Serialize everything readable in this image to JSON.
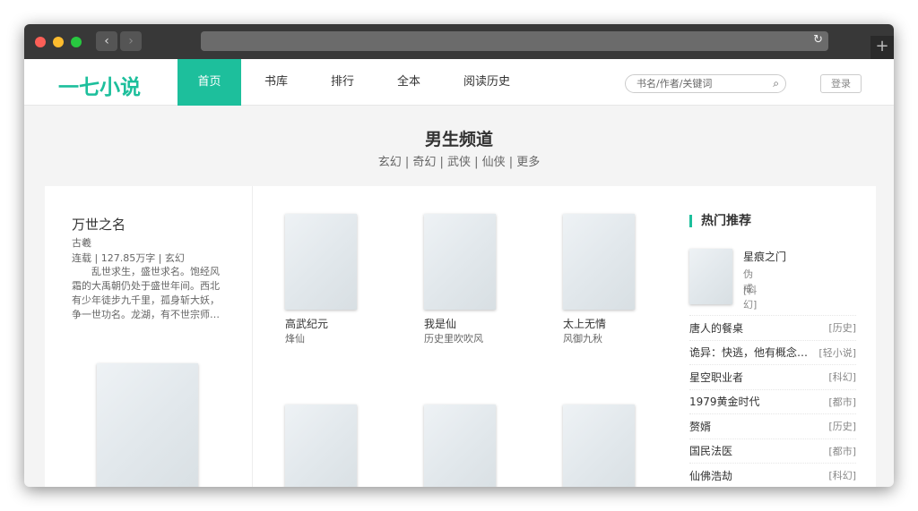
{
  "browser": {
    "back": "‹",
    "forward": "›",
    "reload_icon": "↻",
    "new_tab_icon": "+"
  },
  "header": {
    "logo": "一七小说",
    "nav": [
      "首页",
      "书库",
      "排行",
      "全本",
      "阅读历史"
    ],
    "search_placeholder": "书名/作者/关键词",
    "search_icon": "⌕",
    "login": "登录"
  },
  "channel": {
    "title": "男生频道",
    "categories": "玄幻 | 奇幻 | 武侠 | 仙侠 | 更多"
  },
  "featured": {
    "title": "万世之名",
    "author": "古羲",
    "meta": "连载 | 127.85万字 | 玄幻",
    "desc": "乱世求生，盛世求名。饱经风霜的大禹朝仍处于盛世年间。西北有少年徒步九千里，孤身斩大妖，争一世功名。龙湖，有不世宗师…"
  },
  "books": [
    {
      "title": "高武纪元",
      "author": "烽仙"
    },
    {
      "title": "我是仙",
      "author": "历史里吹吹风"
    },
    {
      "title": "太上无情",
      "author": "风御九秋"
    },
    {
      "title": "",
      "author": ""
    },
    {
      "title": "",
      "author": ""
    },
    {
      "title": "",
      "author": ""
    }
  ],
  "hot": {
    "title": "热门推荐",
    "top": {
      "title": "星痕之门",
      "author": "伪戒",
      "cat": "[科幻]"
    },
    "items": [
      {
        "title": "唐人的餐桌",
        "cat": "[历史]"
      },
      {
        "title": "诡异：快逃，他有概念…",
        "cat": "[轻小说]"
      },
      {
        "title": "星空职业者",
        "cat": "[科幻]"
      },
      {
        "title": "1979黄金时代",
        "cat": "[都市]"
      },
      {
        "title": "赘婿",
        "cat": "[历史]"
      },
      {
        "title": "国民法医",
        "cat": "[都市]"
      },
      {
        "title": "仙佛浩劫",
        "cat": "[科幻]"
      }
    ]
  },
  "colors": {
    "accent": "#1dbf9c"
  }
}
